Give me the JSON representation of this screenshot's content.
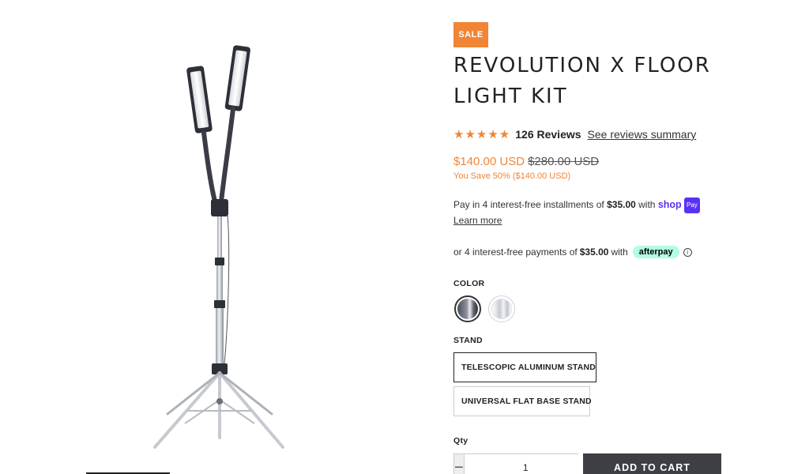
{
  "product": {
    "badge": "SALE",
    "title": "REVOLUTION X FLOOR LIGHT KIT",
    "rating": {
      "stars": "★★★★★",
      "reviews": "126 Reviews",
      "summary_link": "See reviews summary"
    },
    "price": "$140.00 USD",
    "compare_price": "$280.00 USD",
    "savings": "You Save 50% ($140.00 USD)",
    "colors": {
      "accent": "#f08536",
      "shop_pay": "#5a31f4",
      "afterpay": "#b2fce4",
      "button": "#3d3f44"
    }
  },
  "shop_pay": {
    "text_before": "Pay in 4 interest-free installments of ",
    "amount": "$35.00",
    "text_after": " with ",
    "logo": "shop",
    "badge": "Pay",
    "learn_more": "Learn more"
  },
  "afterpay": {
    "text_before": "or 4 interest-free payments of",
    "amount": "$35.00",
    "text_after": "with",
    "badge": "afterpay",
    "info_icon": "ⓘ"
  },
  "options": {
    "color_label": "COLOR",
    "color_swatches": [
      "dark-silver",
      "light-silver"
    ],
    "stand_label": "STAND",
    "stands": [
      "TELESCOPIC ALUMINUM STAND",
      "UNIVERSAL FLAT BASE STAND"
    ]
  },
  "purchase": {
    "qty_label": "Qty",
    "qty_value": "1",
    "minus": "−",
    "plus": "+",
    "add_to_cart": "ADD TO CART"
  }
}
